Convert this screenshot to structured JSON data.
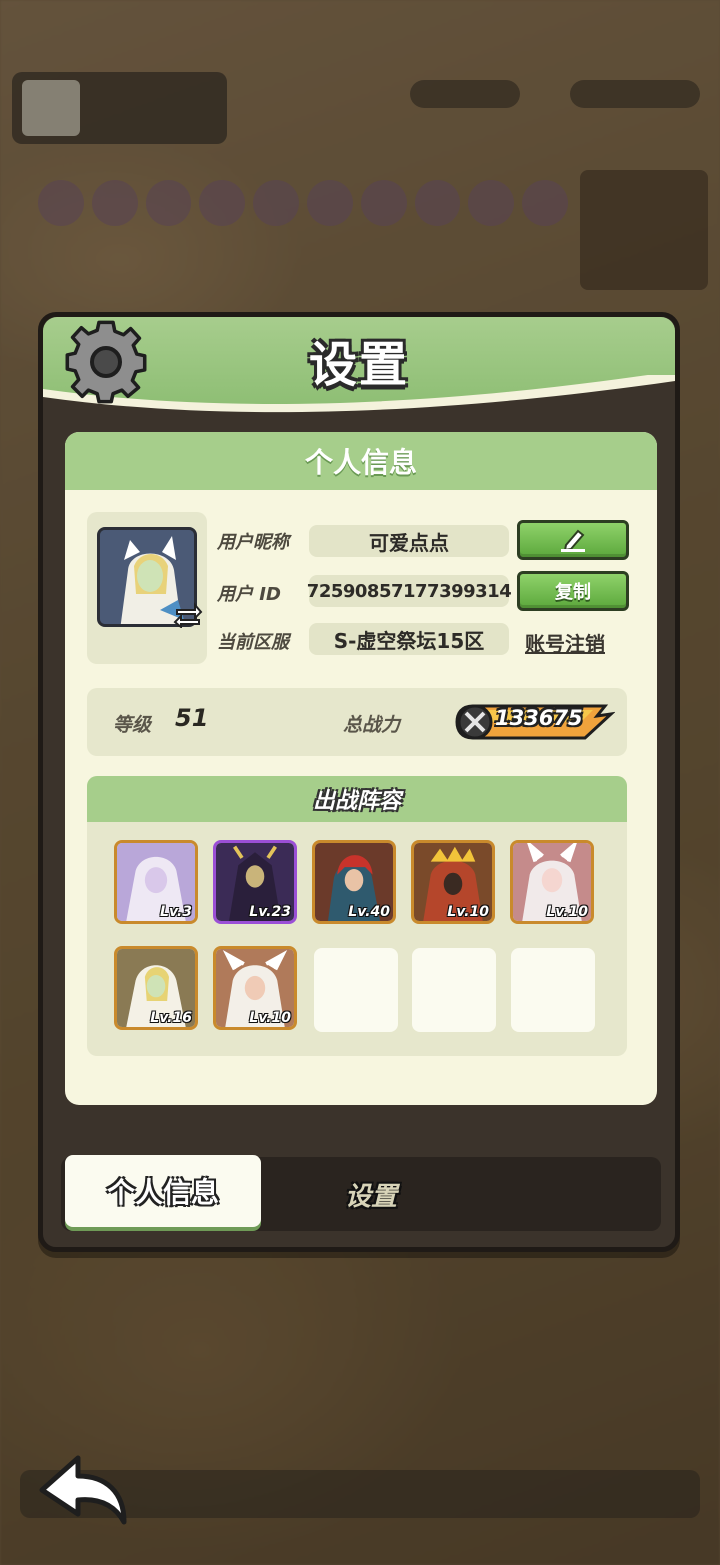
{
  "dialog": {
    "title": "设置",
    "section_title": "个人信息"
  },
  "profile": {
    "nickname_label": "用户昵称",
    "nickname": "可爱点点",
    "id_label": "用户 ID",
    "user_id": "72590857177399314",
    "copy_label": "复制",
    "server_label": "当前区服",
    "server": "S-虚空祭坛15区",
    "logout_label": "账号注销"
  },
  "stats": {
    "level_label": "等级",
    "level": "51",
    "power_label": "总战力",
    "power": "133675"
  },
  "lineup": {
    "title": "出战阵容",
    "heroes": [
      {
        "level": "Lv.3"
      },
      {
        "level": "Lv.23"
      },
      {
        "level": "Lv.40"
      },
      {
        "level": "Lv.10"
      },
      {
        "level": "Lv.10"
      },
      {
        "level": "Lv.16"
      },
      {
        "level": "Lv.10"
      }
    ]
  },
  "tabs": {
    "personal": "个人信息",
    "settings": "设置"
  },
  "colors": {
    "accent_green": "#a6ce8b",
    "panel_bg": "#f7f6df",
    "hero_border_gold": "#c98a2c",
    "hero_border_purple": "#9b4fd6"
  }
}
